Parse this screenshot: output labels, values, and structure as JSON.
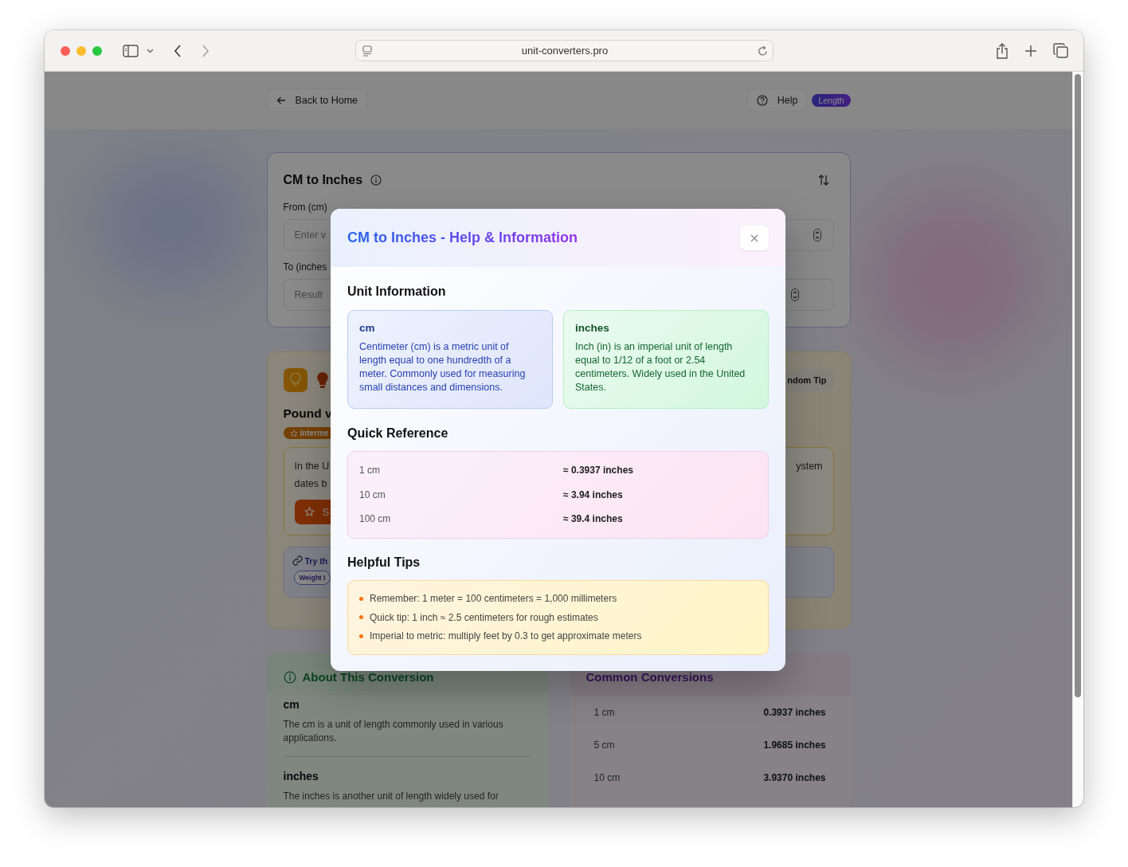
{
  "browser": {
    "url": "unit-converters.pro"
  },
  "header": {
    "back": "Back to Home",
    "help": "Help",
    "category": "Length"
  },
  "converter": {
    "title": "CM to Inches",
    "from_field": {
      "label": "From (cm)",
      "placeholder": "Enter v"
    },
    "to_field": {
      "label": "To (inches",
      "placeholder": "Result"
    }
  },
  "tip_card": {
    "random_button": "ndom Tip",
    "title": "Pound v",
    "level_badge": "interme",
    "text_left": [
      "In the U",
      "dates b"
    ],
    "text_right": "ystem",
    "action_button": "S",
    "related_label": "Try th",
    "related_chip": "Weight I"
  },
  "about": {
    "title": "About This Conversion",
    "units": [
      {
        "name": "cm",
        "description": "The cm is a unit of length commonly used in various applications."
      },
      {
        "name": "inches",
        "description": "The inches is another unit of length widely used for"
      }
    ]
  },
  "common": {
    "title": "Common Conversions",
    "rows": [
      {
        "from": "1 cm",
        "to": "0.3937 inches"
      },
      {
        "from": "5 cm",
        "to": "1.9685 inches"
      },
      {
        "from": "10 cm",
        "to": "3.9370 inches"
      }
    ]
  },
  "modal": {
    "title": "CM to Inches - Help & Information",
    "unit_heading": "Unit Information",
    "units": [
      {
        "kind": "source",
        "name": "cm",
        "description": "Centimeter (cm) is a metric unit of length equal to one hundredth of a meter. Commonly used for measuring small distances and dimensions."
      },
      {
        "kind": "target",
        "name": "inches",
        "description": "Inch (in) is an imperial unit of length equal to 1/12 of a foot or 2.54 centimeters. Widely used in the United States."
      }
    ],
    "reference_heading": "Quick Reference",
    "reference": [
      {
        "from": "1 cm",
        "to": "≈ 0.3937 inches"
      },
      {
        "from": "10 cm",
        "to": "≈ 3.94 inches"
      },
      {
        "from": "100 cm",
        "to": "≈ 39.4 inches"
      }
    ],
    "tips_heading": "Helpful Tips",
    "tips": [
      "Remember: 1 meter = 100 centimeters = 1,000 millimeters",
      "Quick tip: 1 inch ≈ 2.5 centimeters for rough estimates",
      "Imperial to metric: multiply feet by 0.3 to get approximate meters"
    ]
  }
}
